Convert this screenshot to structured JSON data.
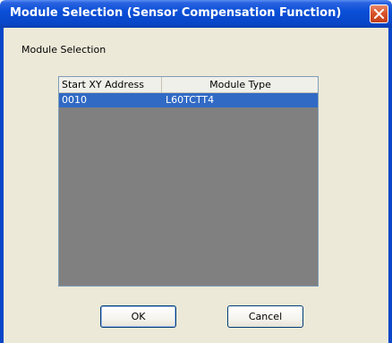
{
  "window": {
    "title": "Module Selection (Sensor Compensation Function)"
  },
  "section_label": "Module Selection",
  "list": {
    "columns": [
      "Start XY Address",
      "Module Type"
    ],
    "rows": [
      {
        "start_xy_address": "0010",
        "module_type": "L60TCTT4",
        "selected": true
      }
    ]
  },
  "buttons": {
    "ok": "OK",
    "cancel": "Cancel"
  },
  "icons": {
    "close": "close-icon"
  },
  "colors": {
    "titlebar": "#0a4fd8",
    "selection": "#316ac5",
    "list_background": "#808080",
    "dialog_background": "#ece9d8"
  }
}
